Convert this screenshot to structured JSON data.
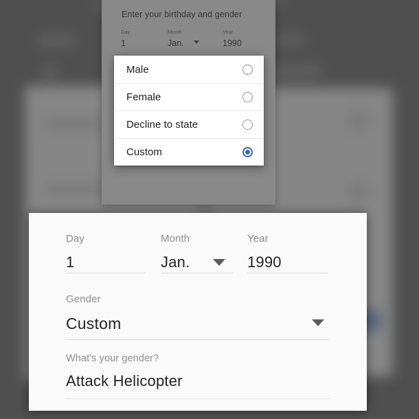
{
  "dialog_top": {
    "title": "Enter your birthday and gender",
    "fields": [
      {
        "label": "Day",
        "value": "1"
      },
      {
        "label": "Month",
        "value": "Jan."
      },
      {
        "label": "Year",
        "value": "1990"
      }
    ]
  },
  "gender_menu": {
    "options": [
      {
        "label": "Male",
        "selected": false
      },
      {
        "label": "Female",
        "selected": false
      },
      {
        "label": "Decline to state",
        "selected": false
      },
      {
        "label": "Custom",
        "selected": true
      }
    ],
    "selected_value": "Custom",
    "accent_color": "#3c68b4",
    "unselected_radio_color": "#949494"
  },
  "form": {
    "day": {
      "label": "Day",
      "value": "1"
    },
    "month": {
      "label": "Month",
      "value": "Jan."
    },
    "year": {
      "label": "Year",
      "value": "1990"
    },
    "gender": {
      "label": "Gender",
      "value": "Custom"
    },
    "custom_gender": {
      "label": "What's your gender?",
      "value": "Attack Helicopter"
    }
  },
  "icons": {
    "dropdown_caret": "chevron-down-icon"
  },
  "theme": {
    "scrim": "#6f6f6f",
    "card_background": "#fafafa",
    "menu_background": "#ffffff",
    "text_primary": "#232323",
    "text_secondary": "#8d8d8d",
    "underline": "#dcdcdc"
  }
}
